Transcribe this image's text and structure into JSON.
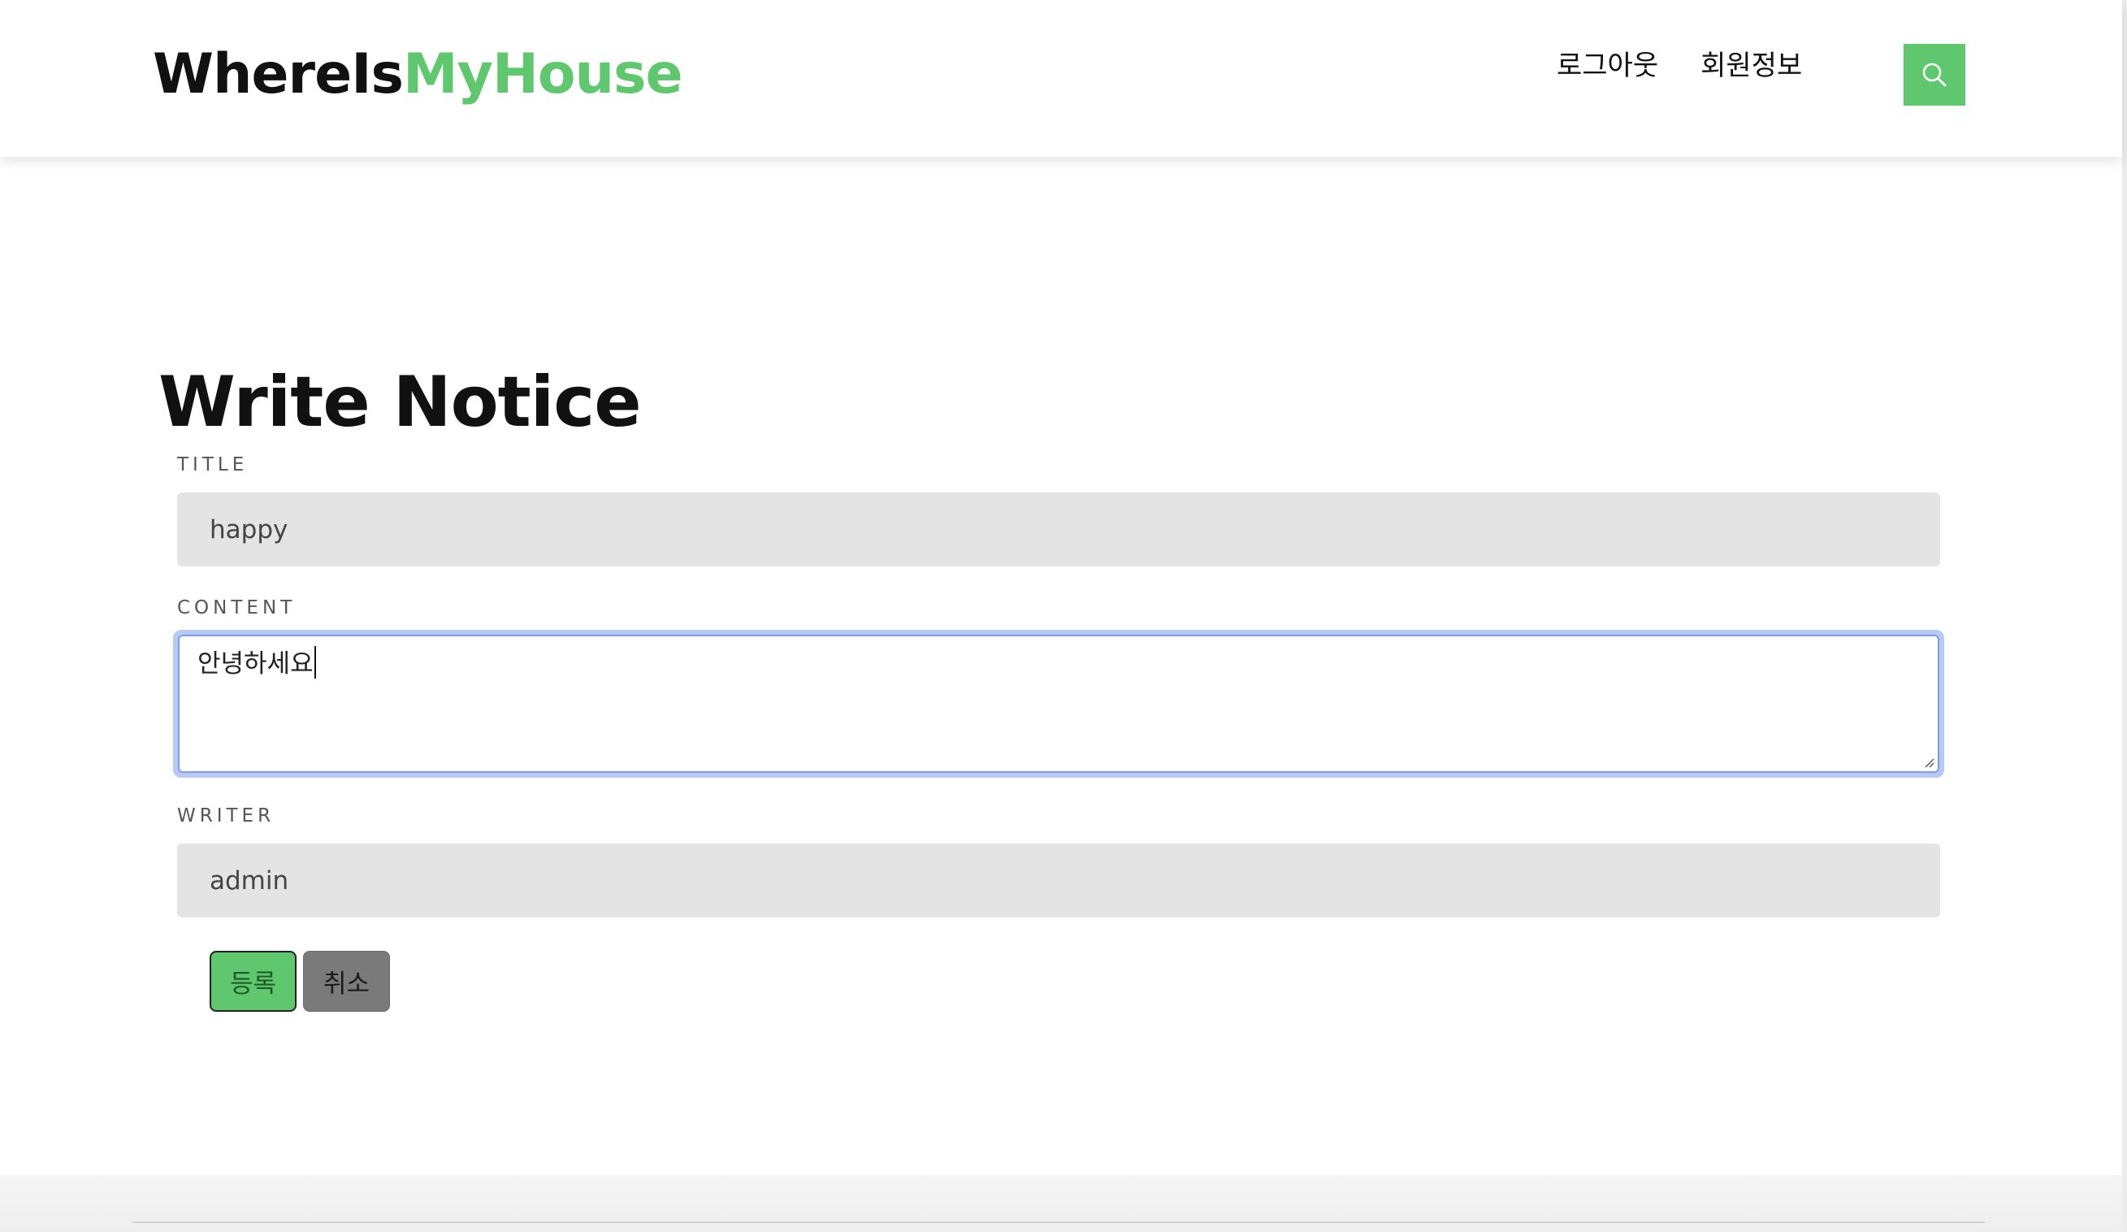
{
  "header": {
    "logo_part1": "WhereIs",
    "logo_part2": "MyHouse",
    "nav": {
      "logout": "로그아웃",
      "member_info": "회원정보"
    },
    "search_icon": "search-icon"
  },
  "main": {
    "title": "Write Notice",
    "form": {
      "title_label": "TITLE",
      "title_value": "happy",
      "content_label": "CONTENT",
      "content_value": "안녕하세요",
      "writer_label": "WRITER",
      "writer_value": "admin",
      "submit_label": "등록",
      "cancel_label": "취소"
    }
  },
  "colors": {
    "accent": "#5fc86e",
    "input_bg": "#e4e4e4",
    "focus_ring": "#b9c9f7",
    "cancel_bg": "#7a7a7a"
  }
}
